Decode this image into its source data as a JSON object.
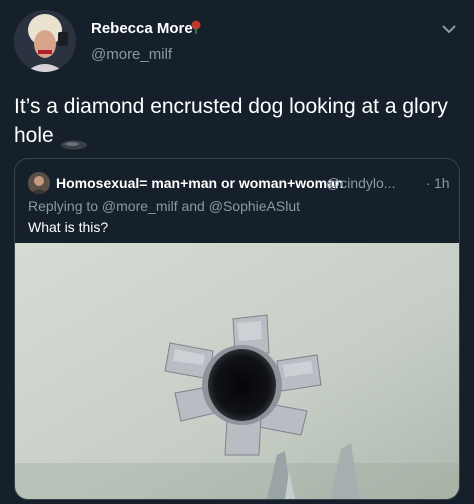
{
  "tweet": {
    "display_name": "Rebecca More",
    "handle": "@more_milf",
    "text": "It’s a diamond encrusted dog looking at a glory hole",
    "avatar_icon": "profile-photo",
    "badge_icon": "rose-emoji-icon",
    "trailing_emoji_icon": "dark-disc-emoji-icon",
    "menu_icon": "chevron-down-icon"
  },
  "quoted_tweet": {
    "display_name": "Homosexual= man+man or woman+woman",
    "handle": "@cindylo...",
    "separator": "·",
    "time": "1h",
    "reply_context": "Replying to @more_milf and @SophieASlut",
    "text": "What is this?",
    "media": "photo-hole-in-wall-with-tape"
  },
  "colors": {
    "background": "#15202b",
    "secondary_text": "#8899a6",
    "border": "#38444d"
  }
}
